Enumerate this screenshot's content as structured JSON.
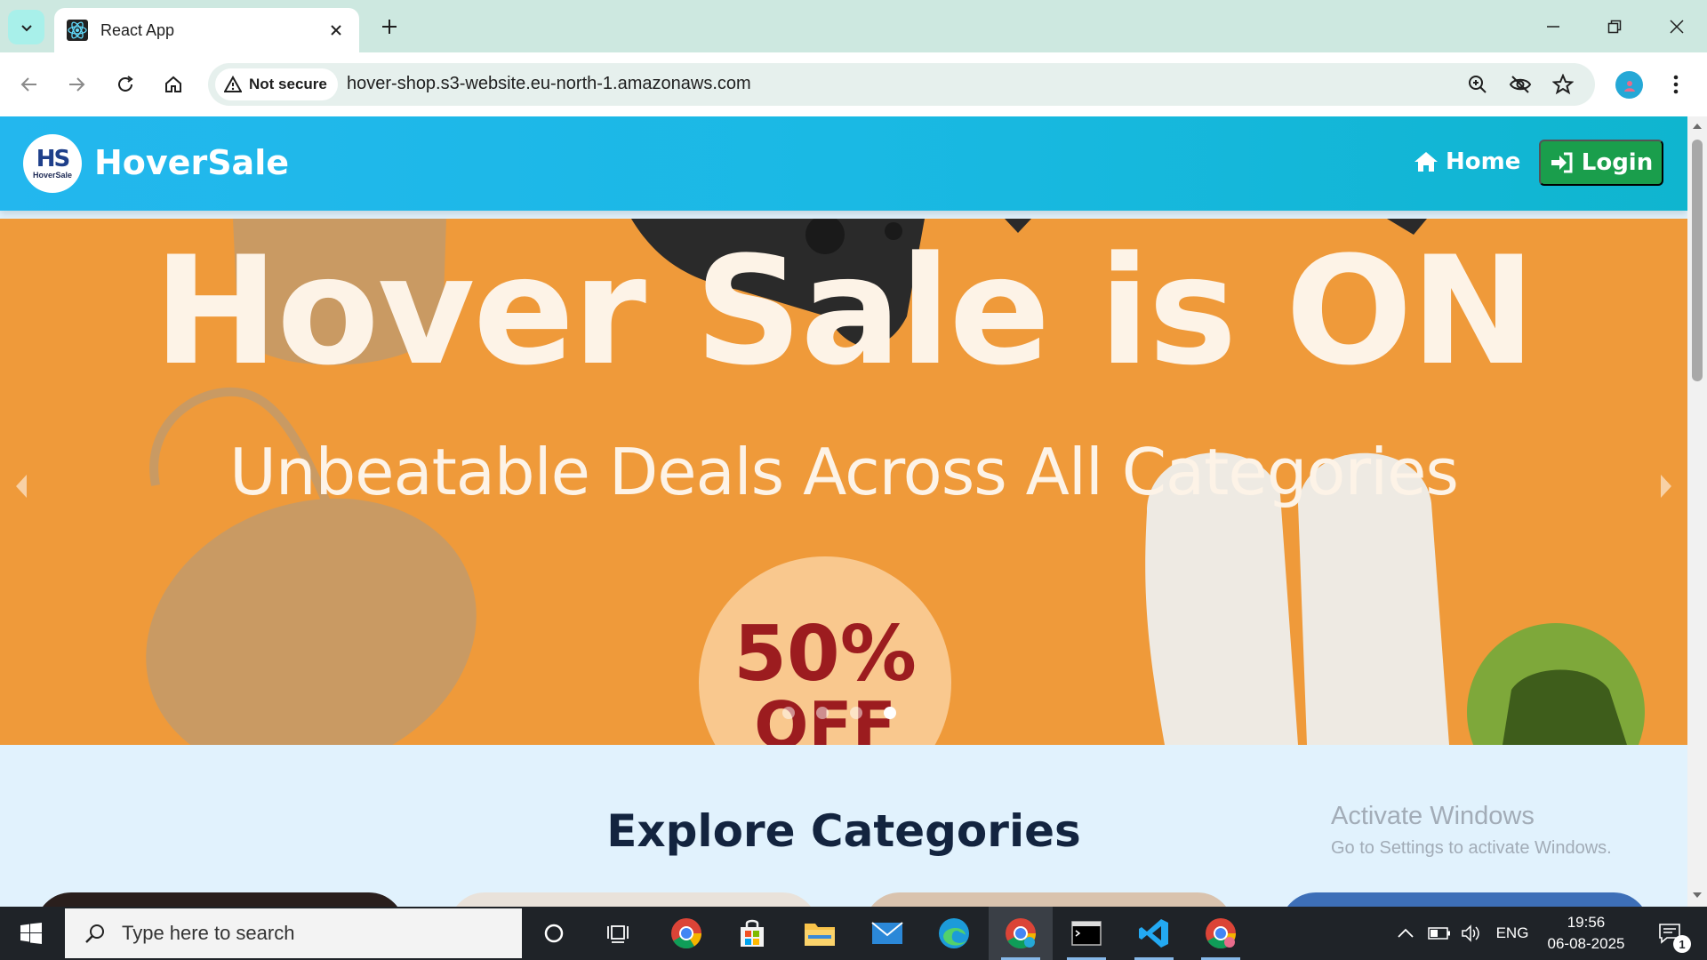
{
  "browser": {
    "tab_title": "React App",
    "security_label": "Not secure",
    "url": "hover-shop.s3-website.eu-north-1.amazonaws.com"
  },
  "site": {
    "brand_logo_text": "HS",
    "brand_logo_sub": "HoverSale",
    "brand_name": "HoverSale",
    "nav_home": "Home",
    "nav_login": "Login"
  },
  "hero": {
    "title": "Hover Sale is ON",
    "subtitle": "Unbeatable Deals Across All Categories",
    "badge_percent": "50%",
    "badge_off": "OFF",
    "slide_count": 4,
    "active_slide": 4
  },
  "categories": {
    "title": "Explore Categories"
  },
  "watermark": {
    "line1": "Activate Windows",
    "line2": "Go to Settings to activate Windows."
  },
  "taskbar": {
    "search_placeholder": "Type here to search",
    "language": "ENG",
    "time": "19:56",
    "date": "06-08-2025",
    "notification_count": "1"
  },
  "colors": {
    "header_gradient_start": "#23b7ee",
    "login_button": "#1a9e4c",
    "hero_background": "#ef9a3a",
    "page_background": "#e1f2fd",
    "heading_text": "#13243f"
  }
}
